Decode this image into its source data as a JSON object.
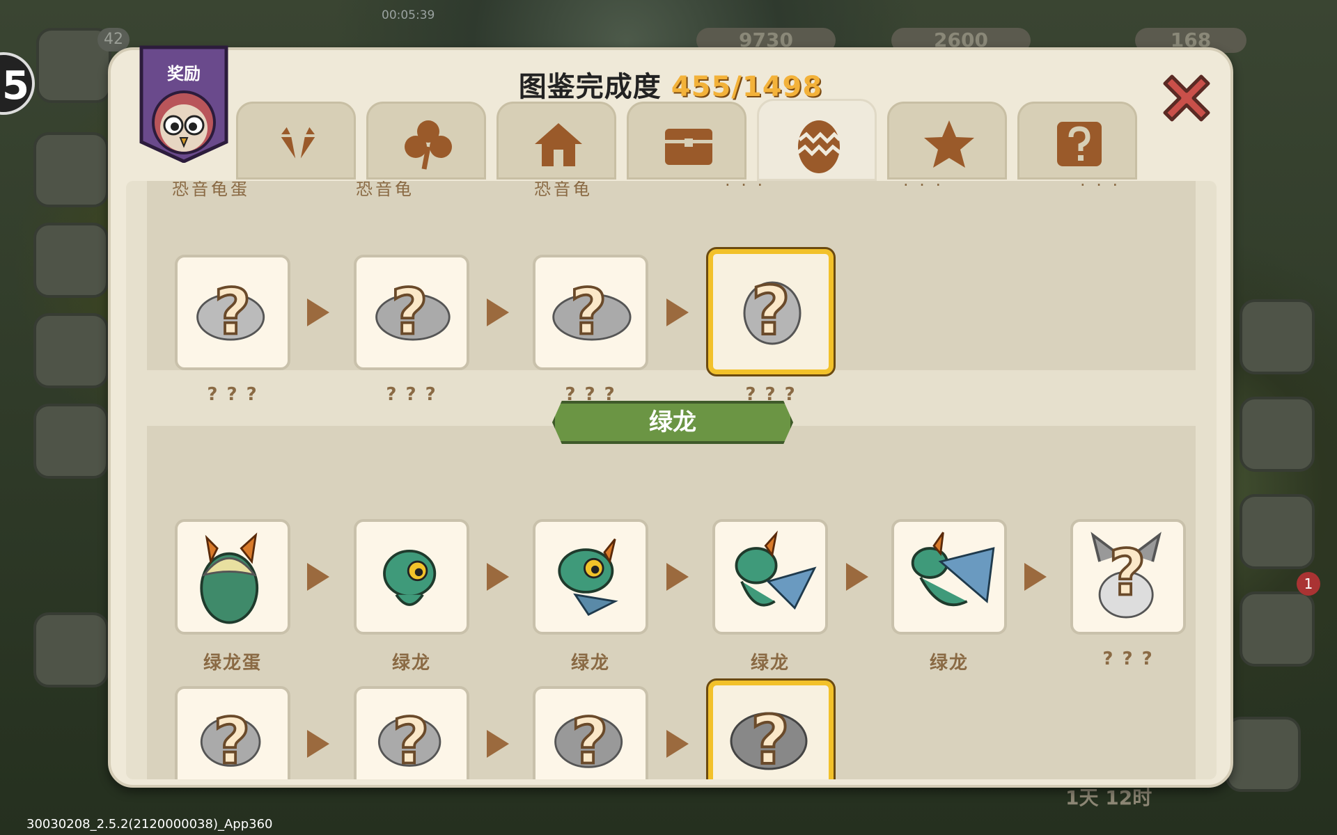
{
  "hud": {
    "timer_label": "00:05:39",
    "avatar_level": "42",
    "player_level": "5",
    "gold": "9730",
    "gems": "2600",
    "other": "168",
    "time_left": "1天 12时",
    "notification_count": "1",
    "version": "30030208_2.5.2(2120000038)_App360"
  },
  "panel": {
    "reward_label": "奖励",
    "title": "图鉴完成度",
    "progress": "455/1498",
    "tabs": [
      "gem-icon",
      "clover-icon",
      "house-icon",
      "chest-icon",
      "egg-icon",
      "star-icon",
      "question-icon"
    ],
    "active_tab": 4
  },
  "top_row": {
    "cropped_labels": [
      "恐音龟蛋",
      "恐音龟",
      "恐音龟",
      "· · ·",
      "· · ·",
      "· · ·"
    ],
    "labels": [
      "? ? ?",
      "? ? ?",
      "? ? ?",
      "? ? ?"
    ]
  },
  "green_dragon": {
    "title": "绿龙",
    "row1_labels": [
      "绿龙蛋",
      "绿龙",
      "绿龙",
      "绿龙",
      "绿龙",
      "? ? ?"
    ],
    "row2_labels": [
      "? ? ?",
      "? ? ?",
      "? ? ?",
      "? ? ?"
    ]
  },
  "colors": {
    "gold_frame": "#f2c12a",
    "group_banner": "#6b9544",
    "arrow": "#9b6a3e",
    "progress": "#f3b23a"
  }
}
